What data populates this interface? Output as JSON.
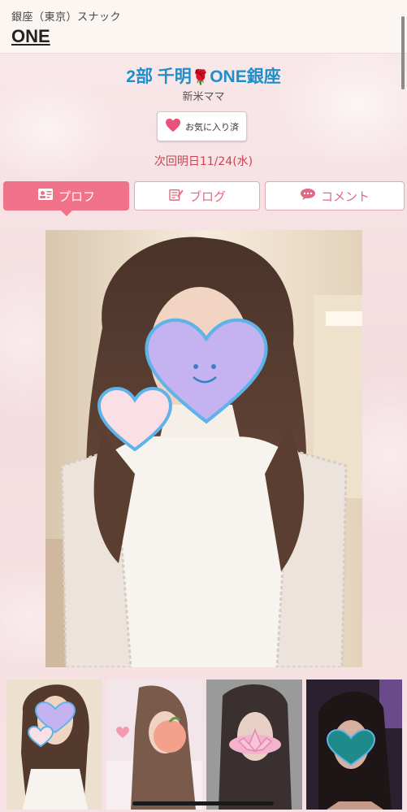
{
  "header": {
    "subtitle": "銀座（東京）スナック",
    "title": "ONE"
  },
  "profile": {
    "cast_name_prefix": "2部 千明",
    "rose_icon": "🌹",
    "cast_name_suffix": "ONE銀座",
    "role": "新米ママ",
    "favorite_label": "お気に入り済",
    "next_visit": "次回明日11/24(水)"
  },
  "tabs": [
    {
      "label": "プロフ",
      "icon": "profile-card-icon",
      "active": true
    },
    {
      "label": "ブログ",
      "icon": "blog-edit-icon",
      "active": false
    },
    {
      "label": "コメント",
      "icon": "comment-bubble-icon",
      "active": false
    }
  ],
  "colors": {
    "accent_pink": "#f0738a",
    "name_blue": "#1e8fc8",
    "date_red": "#d2404f"
  },
  "thumbnails": [
    {
      "name": "thumb-1"
    },
    {
      "name": "thumb-2"
    },
    {
      "name": "thumb-3"
    },
    {
      "name": "thumb-4"
    }
  ]
}
